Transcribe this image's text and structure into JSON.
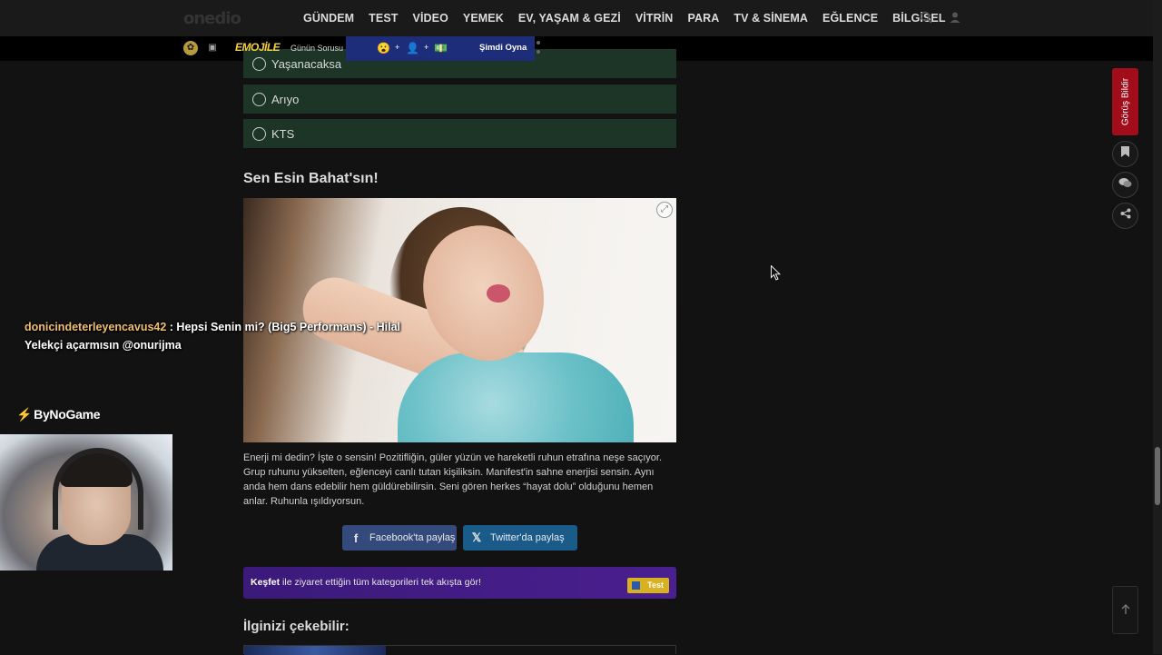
{
  "site": {
    "logo": "onedio"
  },
  "nav": {
    "items": [
      "GÜNDEM",
      "TEST",
      "VİDEO",
      "YEMEK",
      "EV, YAŞAM & GEZİ",
      "VİTRİN",
      "PARA",
      "TV & SİNEMA",
      "EĞLENCE",
      "BİLGİSEL"
    ],
    "search_icon": "search-icon",
    "user_icon": "user-icon"
  },
  "subbar": {
    "emojile": "EMOJİLE",
    "gunun_sorusu": "Günün Sorusu",
    "play": "Şimdi Oyna",
    "plus": "+"
  },
  "quiz": {
    "options": [
      "Yaşanacaksa",
      "Arıyo",
      "KTS"
    ]
  },
  "result": {
    "title": "Sen Esin Bahat'sın!",
    "text": "Enerji mi dedin? İşte o sensin! Pozitifliğin, güler yüzün ve hareketli ruhun etrafına neşe saçıyor. Grup ruhunu yükselten, eğlenceyi canlı tutan kişiliksin. Manifest'in sahne enerjisi sensin. Aynı anda hem dans edebilir hem güldürebilirsin. Seni gören herkes “hayat dolu” olduğunu hemen anlar. Ruhunla ışıldıyorsun."
  },
  "share": {
    "facebook": "Facebook'ta paylaş",
    "twitter": "Twitter'da paylaş"
  },
  "kesfet": {
    "bold": "Keşfet",
    "text": " ile ziyaret ettiğin tüm kategorileri tek akışta gör!",
    "badge": "Test"
  },
  "related": {
    "title": "İlginizi çekebilir:"
  },
  "sidebar": {
    "feedback": "Görüş Bildir"
  },
  "overlay": {
    "chat_user": "donicindeterleyencavus42",
    "chat_message": " : Hepsi Senin mi? (Big5 Performans) - Hilal Yelekçi açarmısın @onurijma",
    "brand": "ByNoGame"
  }
}
